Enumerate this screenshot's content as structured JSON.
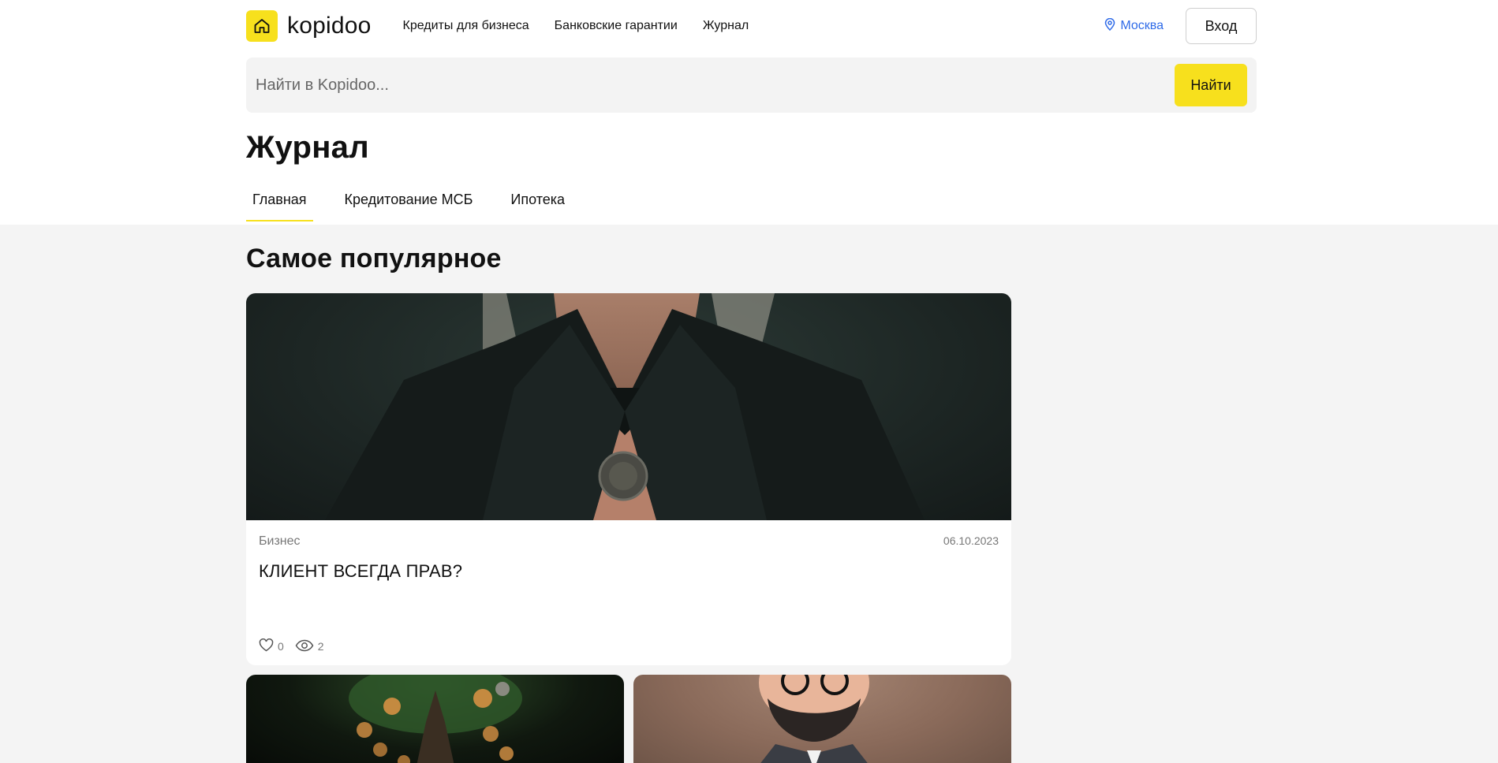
{
  "header": {
    "logo_text": "kopidoo",
    "nav": [
      "Кредиты для бизнеса",
      "Банковские гарантии",
      "Журнал"
    ],
    "city": "Москва",
    "login_label": "Вход"
  },
  "search": {
    "placeholder": "Найти в Kopidoo...",
    "button_label": "Найти"
  },
  "page": {
    "title": "Журнал",
    "tabs": [
      {
        "label": "Главная",
        "active": true
      },
      {
        "label": "Кредитование МСБ",
        "active": false
      },
      {
        "label": "Ипотека",
        "active": false
      }
    ]
  },
  "popular": {
    "heading": "Самое популярное",
    "main_card": {
      "category": "Бизнес",
      "date": "06.10.2023",
      "title": "КЛИЕНТ ВСЕГДА ПРАВ?",
      "likes": "0",
      "views": "2"
    }
  },
  "colors": {
    "accent": "#f7e01d",
    "link": "#2f6be8"
  }
}
